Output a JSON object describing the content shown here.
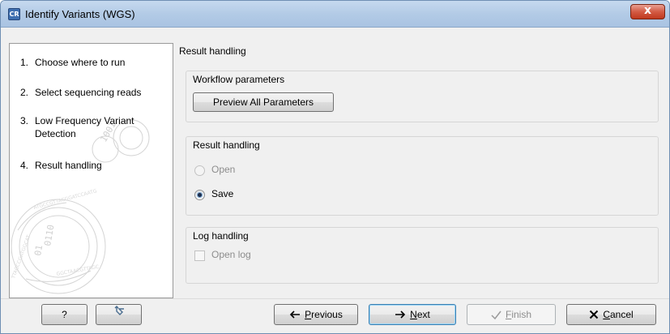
{
  "window": {
    "title": "Identify Variants (WGS)",
    "app_icon_text": "CR",
    "close_symbol": "x"
  },
  "sidebar": {
    "steps": [
      {
        "num": "1.",
        "label": "Choose where to run"
      },
      {
        "num": "2.",
        "label": "Select sequencing reads"
      },
      {
        "num": "3.",
        "label": "Low Frequency Variant Detection"
      },
      {
        "num": "4.",
        "label": "Result handling"
      }
    ]
  },
  "content": {
    "header": "Result handling",
    "workflow_group": {
      "title": "Workflow parameters",
      "preview_button": "Preview All Parameters"
    },
    "result_group": {
      "title": "Result handling",
      "options": [
        {
          "label": "Open",
          "checked": false,
          "enabled": false
        },
        {
          "label": "Save",
          "checked": true,
          "enabled": true
        }
      ]
    },
    "log_group": {
      "title": "Log handling",
      "checkbox_label": "Open log",
      "checked": false
    }
  },
  "footer": {
    "help_label": "?",
    "previous": {
      "mnemonic": "P",
      "rest": "revious"
    },
    "next": {
      "mnemonic": "N",
      "rest": "ext"
    },
    "finish": {
      "mnemonic": "F",
      "rest": "inish"
    },
    "cancel": {
      "mnemonic": "C",
      "rest": "ancel"
    }
  },
  "colors": {
    "window_bg": "#f0f0f0",
    "title_gradient": "#b3cbe6",
    "close_red": "#c0391e",
    "default_button_border": "#3c7fb1"
  }
}
